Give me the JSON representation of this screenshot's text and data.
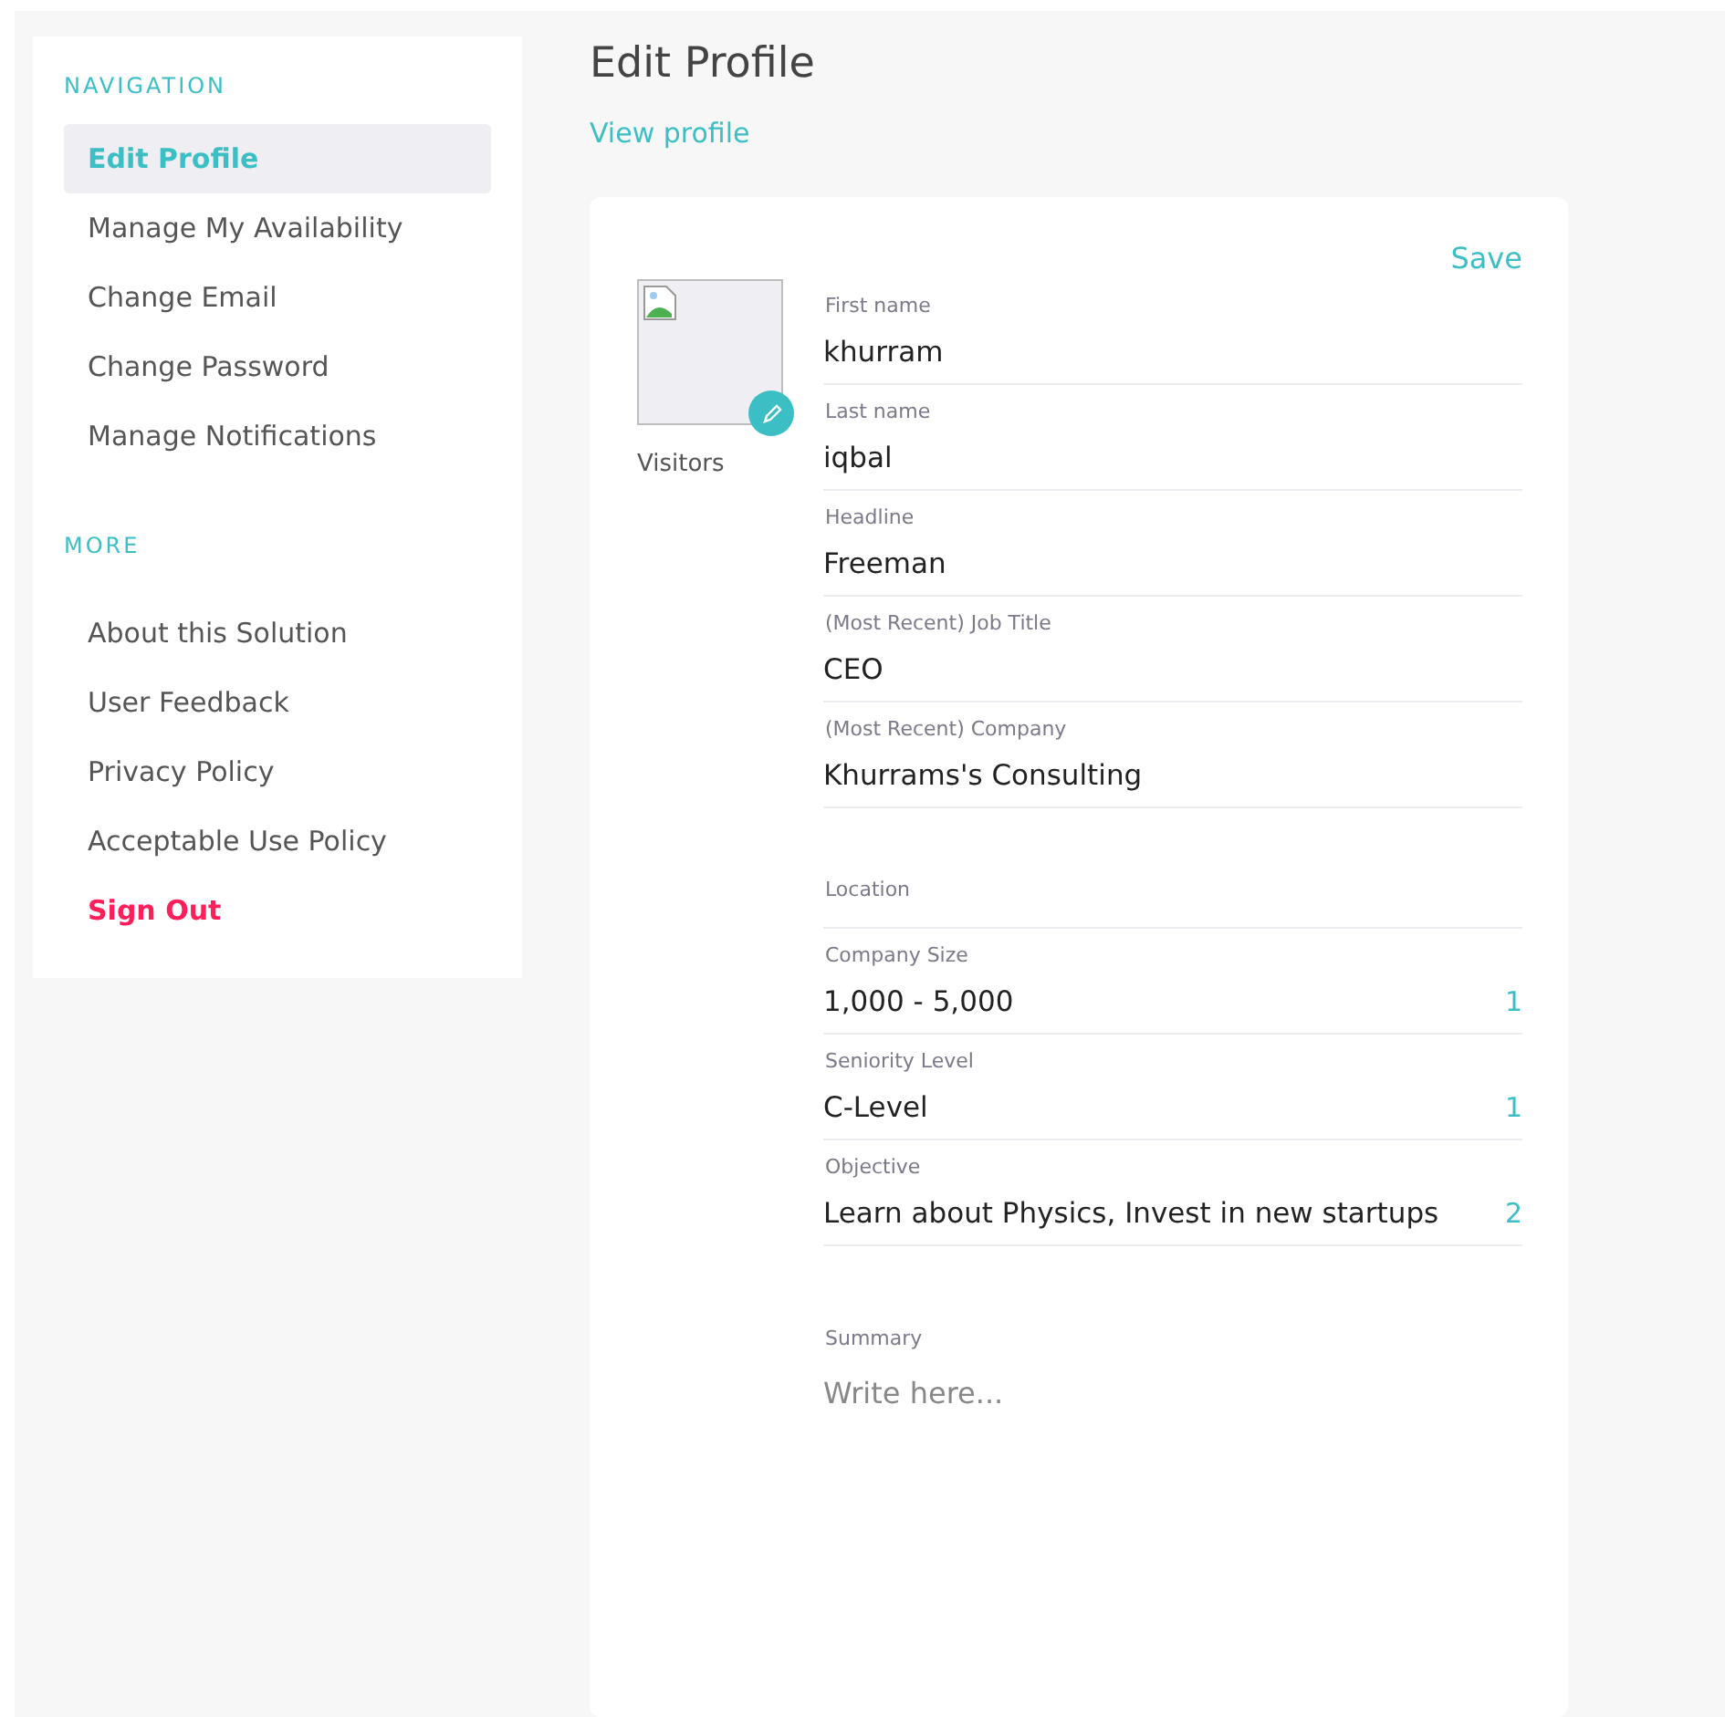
{
  "sidebar": {
    "sections": [
      {
        "heading": "NAVIGATION",
        "items": [
          {
            "label": "Edit Profile",
            "selected": true,
            "kind": "link"
          },
          {
            "label": "Manage My Availability",
            "selected": false,
            "kind": "link"
          },
          {
            "label": "Change Email",
            "selected": false,
            "kind": "link"
          },
          {
            "label": "Change Password",
            "selected": false,
            "kind": "link"
          },
          {
            "label": "Manage Notifications",
            "selected": false,
            "kind": "link"
          }
        ]
      },
      {
        "heading": "MORE",
        "items": [
          {
            "label": "About this Solution",
            "selected": false,
            "kind": "link"
          },
          {
            "label": "User Feedback",
            "selected": false,
            "kind": "link"
          },
          {
            "label": "Privacy Policy",
            "selected": false,
            "kind": "link"
          },
          {
            "label": "Acceptable Use Policy",
            "selected": false,
            "kind": "link"
          },
          {
            "label": "Sign Out",
            "selected": false,
            "kind": "danger"
          }
        ]
      }
    ]
  },
  "page": {
    "title": "Edit Profile",
    "view_link": "View profile"
  },
  "form": {
    "save": "Save",
    "avatar_caption": "Visitors",
    "fields": [
      {
        "kind": "text",
        "label": "First name",
        "value": "khurram"
      },
      {
        "kind": "text",
        "label": "Last name",
        "value": "iqbal"
      },
      {
        "kind": "text",
        "label": "Headline",
        "value": "Freeman"
      },
      {
        "kind": "text",
        "label": "(Most Recent) Job Title",
        "value": "CEO"
      },
      {
        "kind": "text",
        "label": "(Most Recent) Company",
        "value": "Khurrams's Consulting"
      },
      {
        "kind": "empty",
        "label": "Location"
      },
      {
        "kind": "select",
        "label": "Company Size",
        "value": "1,000 - 5,000",
        "count": "1"
      },
      {
        "kind": "select",
        "label": "Seniority Level",
        "value": "C-Level",
        "count": "1"
      },
      {
        "kind": "select",
        "label": "Objective",
        "value": "Learn about Physics, Invest in new startups",
        "count": "2"
      },
      {
        "kind": "textarea",
        "label": "Summary",
        "placeholder": "Write here..."
      }
    ]
  }
}
